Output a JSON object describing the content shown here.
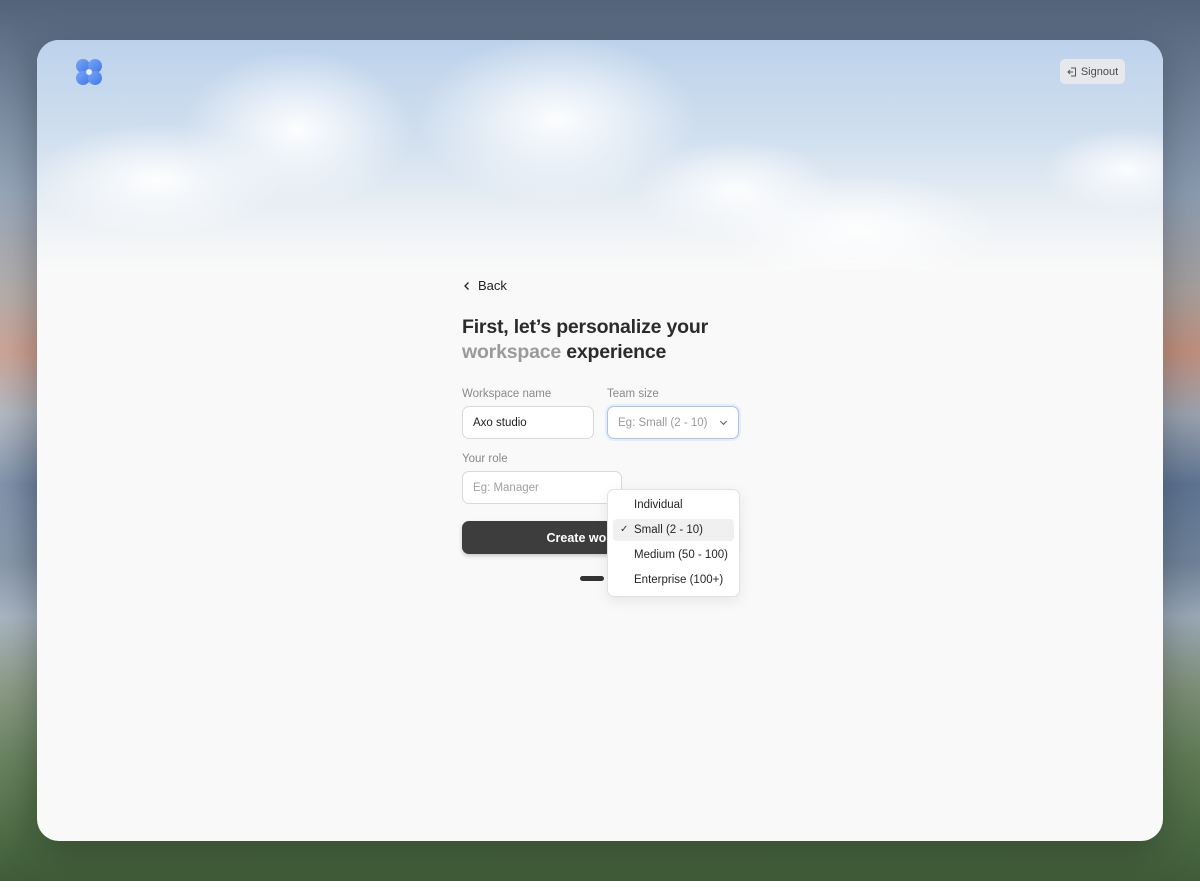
{
  "header": {
    "logo_icon": "flower-logo-icon",
    "signout_label": "Signout",
    "signout_icon": "signout-icon"
  },
  "form": {
    "back_label": "Back",
    "title_line1": "First, let’s personalize your",
    "title_muted": "workspace",
    "title_rest": "experience",
    "workspace_name": {
      "label": "Workspace name",
      "value": "Axo studio"
    },
    "team_size": {
      "label": "Team size",
      "placeholder": "Eg: Small (2 - 10)",
      "options": [
        "Individual",
        "Small (2 - 10)",
        "Medium (50 - 100)",
        "Enterprise (100+)"
      ],
      "selected": "Small (2 - 10)"
    },
    "role": {
      "label": "Your role",
      "placeholder": "Eg: Manager"
    },
    "create_label": "Create workspace",
    "steps": {
      "total": 3,
      "current": 1
    }
  },
  "colors": {
    "accent_logo": "#5b8def",
    "button_dark": "#3d3d3d"
  }
}
